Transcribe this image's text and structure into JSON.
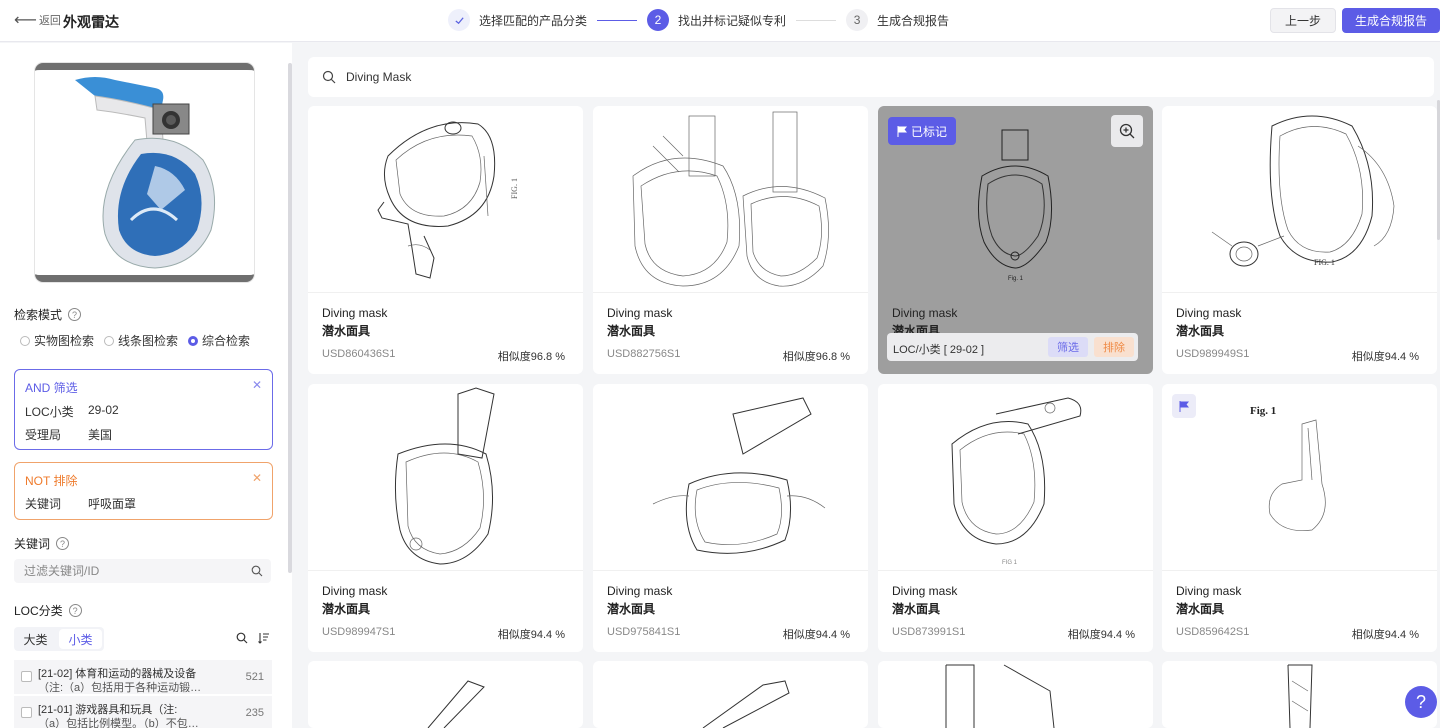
{
  "header": {
    "back_label": "返回",
    "app_title": "外观雷达",
    "steps": [
      {
        "num": "✓",
        "label": "选择匹配的产品分类"
      },
      {
        "num": "2",
        "label": "找出并标记疑似专利"
      },
      {
        "num": "3",
        "label": "生成合规报告"
      }
    ],
    "prev_label": "上一步",
    "report_label": "生成合规报告"
  },
  "sidebar": {
    "search_mode_title": "检索模式",
    "modes": [
      "实物图检索",
      "线条图检索",
      "综合检索"
    ],
    "and_filter": {
      "title": "AND  筛选",
      "rows": [
        {
          "k": "LOC小类",
          "v": "29-02"
        },
        {
          "k": "受理局",
          "v": "美国"
        }
      ]
    },
    "not_filter": {
      "title": "NOT  排除",
      "rows": [
        {
          "k": "关键词",
          "v": "呼吸面罩"
        }
      ]
    },
    "keyword_title": "关键词",
    "keyword_placeholder": "过滤关键词/ID",
    "loc_title": "LOC分类",
    "loc_tabs": [
      "大类",
      "小类"
    ],
    "loc_items": [
      {
        "line1": "[21-02] 体育和运动的器械及设备",
        "line2": "（注:（a）包括用于各种运动锻…",
        "count": "521"
      },
      {
        "line1": "[21-01] 游戏器具和玩具（注:",
        "line2": "（a）包括比例模型。（b）不包…",
        "count": "235"
      }
    ]
  },
  "search": {
    "query": "Diving Mask"
  },
  "cards": [
    {
      "name": "Diving mask",
      "cn": "潜水面具",
      "pn": "USD860436S1",
      "sim": "相似度96.8 %"
    },
    {
      "name": "Diving mask",
      "cn": "潜水面具",
      "pn": "USD882756S1",
      "sim": "相似度96.8 %"
    },
    {
      "name": "Diving mask",
      "cn": "潜水面具",
      "marked_label": "已标记",
      "loc_label": "LOC/小类 [ 29-02 ]",
      "filter_label": "筛选",
      "exclude_label": "排除",
      "fig_label": "Fig. 1"
    },
    {
      "name": "Diving mask",
      "cn": "潜水面具",
      "pn": "USD989949S1",
      "sim": "相似度94.4 %",
      "fig_label": "FIG. 1"
    },
    {
      "name": "Diving mask",
      "cn": "潜水面具",
      "pn": "USD989947S1",
      "sim": "相似度94.4 %"
    },
    {
      "name": "Diving mask",
      "cn": "潜水面具",
      "pn": "USD975841S1",
      "sim": "相似度94.4 %"
    },
    {
      "name": "Diving mask",
      "cn": "潜水面具",
      "pn": "USD873991S1",
      "sim": "相似度94.4 %",
      "fig_label": "FIG 1"
    },
    {
      "name": "Diving mask",
      "cn": "潜水面具",
      "pn": "USD859642S1",
      "sim": "相似度94.4 %",
      "fig_label": "Fig. 1"
    }
  ],
  "card0_fig_label": "FIG. 1",
  "help_label": "?"
}
